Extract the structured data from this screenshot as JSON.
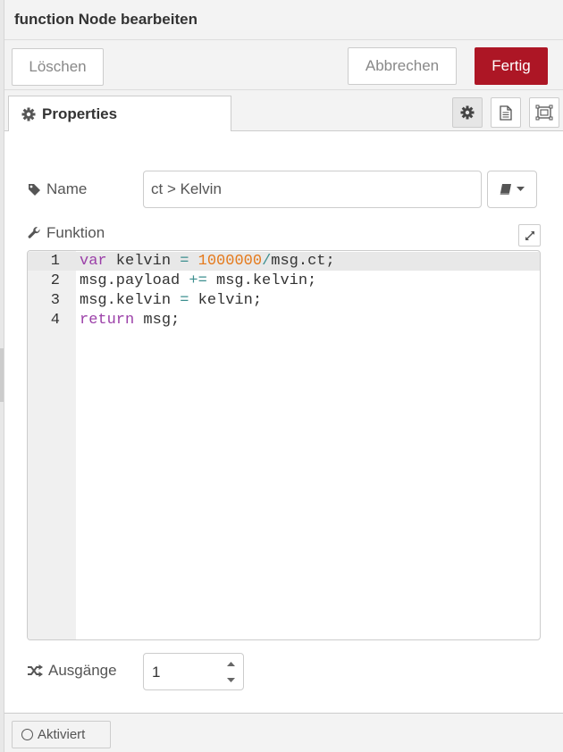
{
  "dialog": {
    "title": "function Node bearbeiten"
  },
  "toolbar": {
    "delete_label": "Löschen",
    "cancel_label": "Abbrechen",
    "done_label": "Fertig",
    "done_color": "#ad1625"
  },
  "tabs": [
    {
      "label": "Properties",
      "icon": "gear-icon"
    }
  ],
  "tab_icons": [
    "gear-icon",
    "document-icon",
    "frame-icon"
  ],
  "form": {
    "name_label": "Name",
    "name_value": "ct > Kelvin",
    "function_label": "Funktion",
    "outputs_label": "Ausgänge",
    "outputs_value": "1"
  },
  "editor": {
    "line_numbers": [
      "1",
      "2",
      "3",
      "4"
    ],
    "lines": [
      [
        {
          "t": "var",
          "c": "kw"
        },
        {
          "t": " kelvin ",
          "c": ""
        },
        {
          "t": "=",
          "c": "op"
        },
        {
          "t": " ",
          "c": ""
        },
        {
          "t": "1000000",
          "c": "num"
        },
        {
          "t": "/",
          "c": "op"
        },
        {
          "t": "msg.ct;",
          "c": ""
        }
      ],
      [
        {
          "t": "msg.payload ",
          "c": ""
        },
        {
          "t": "+=",
          "c": "op"
        },
        {
          "t": " msg.kelvin;",
          "c": ""
        }
      ],
      [
        {
          "t": "msg.kelvin ",
          "c": ""
        },
        {
          "t": "=",
          "c": "op"
        },
        {
          "t": " kelvin;",
          "c": ""
        }
      ],
      [
        {
          "t": "return",
          "c": "kw"
        },
        {
          "t": " msg;",
          "c": ""
        }
      ]
    ],
    "colors": {
      "keyword": "#9b3fa8",
      "number": "#e57a1c",
      "operator": "#3d8f8f"
    }
  },
  "footer": {
    "enabled_label": "Aktiviert"
  }
}
